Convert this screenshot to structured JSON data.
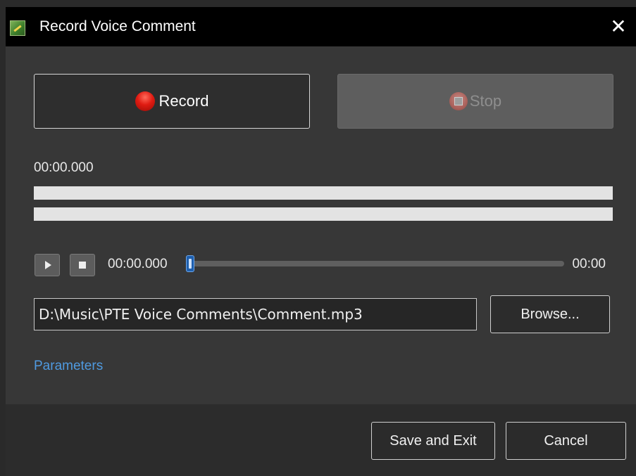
{
  "window": {
    "title": "Record Voice Comment",
    "close_glyph": "✕"
  },
  "recorder": {
    "record_label": "Record",
    "stop_label": "Stop",
    "record_time": "00:00.000"
  },
  "player": {
    "position_time": "00:00.000",
    "duration_time": "00:00",
    "seek_position": 0
  },
  "file": {
    "path_value": "D:\\Music\\PTE Voice Comments\\Comment.mp3",
    "browse_label": "Browse..."
  },
  "links": {
    "parameters_label": "Parameters"
  },
  "footer": {
    "save_label": "Save and Exit",
    "cancel_label": "Cancel"
  },
  "colors": {
    "titlebar": "#000000",
    "body": "#373737",
    "footer": "#2c2c2c",
    "link": "#4f9ae0",
    "record_red": "#e01b12",
    "slider_thumb": "#1e5fae"
  },
  "icons": {
    "app": "app-icon",
    "close": "close-icon",
    "record": "record-icon",
    "stop": "stop-icon",
    "play": "play-icon",
    "stop_small": "stop-square-icon"
  }
}
